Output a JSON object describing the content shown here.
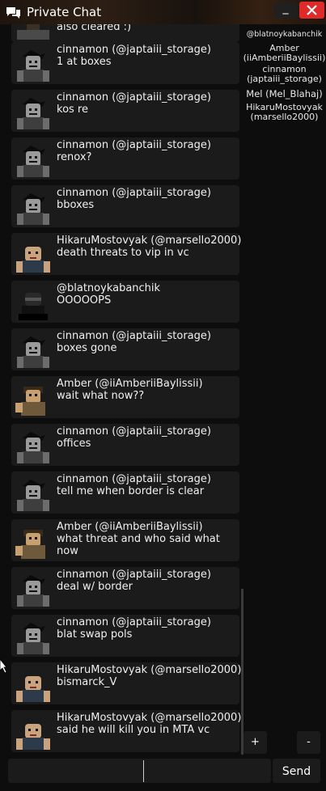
{
  "window": {
    "title": "Private Chat",
    "minimize_label": "_"
  },
  "partial_message": {
    "text": "also cleared :)"
  },
  "messages": [
    {
      "name": "cinnamon (@japtaiii_storage)",
      "text": "1 at boxes"
    },
    {
      "name": "cinnamon (@japtaiii_storage)",
      "text": "kos re"
    },
    {
      "name": "cinnamon (@japtaiii_storage)",
      "text": "renox?"
    },
    {
      "name": "cinnamon (@japtaiii_storage)",
      "text": "bboxes"
    },
    {
      "name": "HikaruMostovyak (@marsello2000)",
      "text": "death threats to vip in vc"
    },
    {
      "name": "@blatnoykabanchik",
      "text": "OOOOOPS"
    },
    {
      "name": "cinnamon (@japtaiii_storage)",
      "text": "boxes gone"
    },
    {
      "name": "Amber (@iiAmberiiBaylissii)",
      "text": "wait what now??"
    },
    {
      "name": "cinnamon (@japtaiii_storage)",
      "text": "offices"
    },
    {
      "name": "cinnamon (@japtaiii_storage)",
      "text": "tell me when border is clear"
    },
    {
      "name": "Amber (@iiAmberiiBaylissii)",
      "text": "what threat and who said what now"
    },
    {
      "name": "cinnamon (@japtaiii_storage)",
      "text": "deal w/ border"
    },
    {
      "name": "cinnamon (@japtaiii_storage)",
      "text": "blat swap pols"
    },
    {
      "name": "HikaruMostovyak (@marsello2000)",
      "text": "bismarck_V"
    },
    {
      "name": "HikaruMostovyak (@marsello2000)",
      "text": "said he will kill you in MTA vc"
    }
  ],
  "members": [
    {
      "line1": "@blatnoykabanchik"
    },
    {
      "line1": "Amber",
      "line2": "(iiAmberiiBaylissii)"
    },
    {
      "line1": "cinnamon",
      "line2": "(japtaiii_storage)"
    },
    {
      "line1": "Mel (Mel_Blahaj)"
    },
    {
      "line1": "HikaruMostovyak",
      "line2": "(marsello2000)"
    }
  ],
  "controls": {
    "plus": "+",
    "minus": "-",
    "send": "Send",
    "input_value": ""
  },
  "colors": {
    "close_button": "#e02a2a",
    "message_bg": "#1b1b1b",
    "window_bg": "#0d0d0d"
  }
}
